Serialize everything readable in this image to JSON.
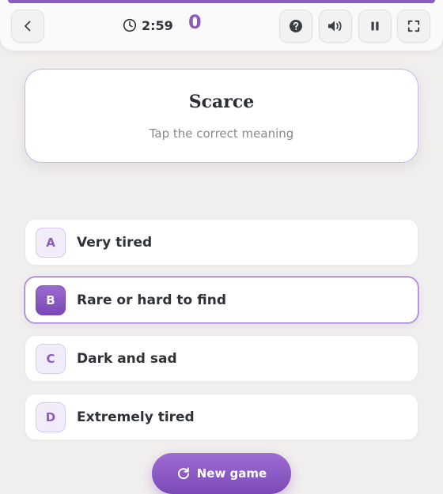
{
  "header": {
    "timer": "2:59",
    "score": "0",
    "icons": {
      "back": "chevron-left-icon",
      "clock": "clock-icon",
      "help": "question-circle-icon",
      "sound": "speaker-icon",
      "pause": "pause-icon",
      "fullscreen": "fullscreen-icon"
    }
  },
  "question": {
    "word": "Scarce",
    "hint": "Tap the correct meaning"
  },
  "options": [
    {
      "letter": "A",
      "text": "Very tired",
      "selected": false
    },
    {
      "letter": "B",
      "text": "Rare or hard to find",
      "selected": true
    },
    {
      "letter": "C",
      "text": "Dark and sad",
      "selected": false
    },
    {
      "letter": "D",
      "text": "Extremely tired",
      "selected": false
    }
  ],
  "footer": {
    "new_game_label": "New game",
    "new_game_icon": "restart-icon"
  },
  "colors": {
    "accent": "#8a5cc0",
    "text": "#2f3237",
    "muted": "#858a8f",
    "background": "#f1efee"
  }
}
